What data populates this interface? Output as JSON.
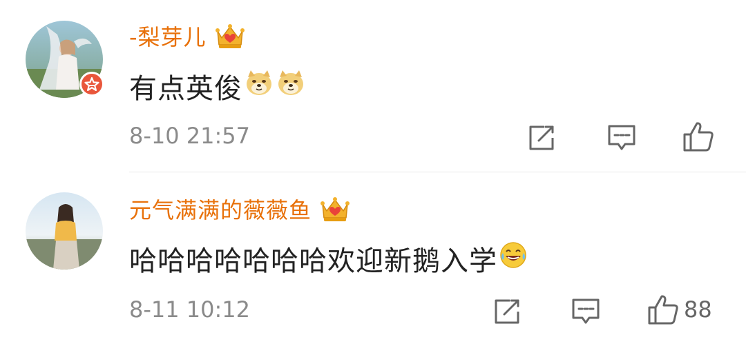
{
  "comments": [
    {
      "username": "-梨芽儿",
      "text": "有点英俊",
      "emojis": [
        "doge-emoji",
        "doge-emoji"
      ],
      "timestamp": "8-10 21:57",
      "avatar_badge": "vip-star-icon",
      "user_badge": "crown-heart-icon",
      "like_count": ""
    },
    {
      "username": "元气满满的薇薇鱼",
      "text": "哈哈哈哈哈哈哈欢迎新鹅入学",
      "emojis": [
        "laugh-tears-emoji"
      ],
      "timestamp": "8-11 10:12",
      "avatar_badge": "",
      "user_badge": "crown-heart-icon",
      "like_count": "88"
    }
  ],
  "colors": {
    "username": "#e8710a",
    "text": "#222222",
    "timestamp": "#8a8a8a",
    "icon": "#666666",
    "divider": "#e6e6e6",
    "badge_red": "#e9563b",
    "crown_gold": "#f3b22d"
  }
}
